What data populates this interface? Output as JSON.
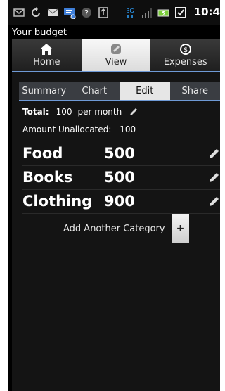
{
  "status_bar": {
    "clock": "10:4",
    "network_label": "3G",
    "icons": [
      "mail-icon",
      "sync-icon",
      "email-icon",
      "chat-icon",
      "help-icon",
      "usb-icon",
      "signal-icon",
      "battery-icon",
      "alarm-icon"
    ]
  },
  "app": {
    "title": "Your budget"
  },
  "tabs": [
    {
      "label": "Home",
      "icon": "home-icon",
      "active": false
    },
    {
      "label": "View",
      "icon": "view-icon",
      "active": true
    },
    {
      "label": "Expenses",
      "icon": "dollar-coin-icon",
      "active": false
    }
  ],
  "subtabs": [
    {
      "label": "Summary",
      "active": false
    },
    {
      "label": "Chart",
      "active": false
    },
    {
      "label": "Edit",
      "active": true
    },
    {
      "label": "Share",
      "active": false
    }
  ],
  "budget": {
    "total_label": "Total:",
    "total_value": "100",
    "period": "per month",
    "unallocated_label": "Amount Unallocated:",
    "unallocated_value": "100"
  },
  "categories": [
    {
      "name": "Food",
      "amount": "500"
    },
    {
      "name": "Books",
      "amount": "500"
    },
    {
      "name": "Clothing",
      "amount": "900"
    }
  ],
  "add_category": {
    "label": "Add Another Category",
    "button": "+"
  },
  "colors": {
    "accent": "#6f9ad6",
    "background": "#000000",
    "active_tab": "#e6e6e6"
  }
}
